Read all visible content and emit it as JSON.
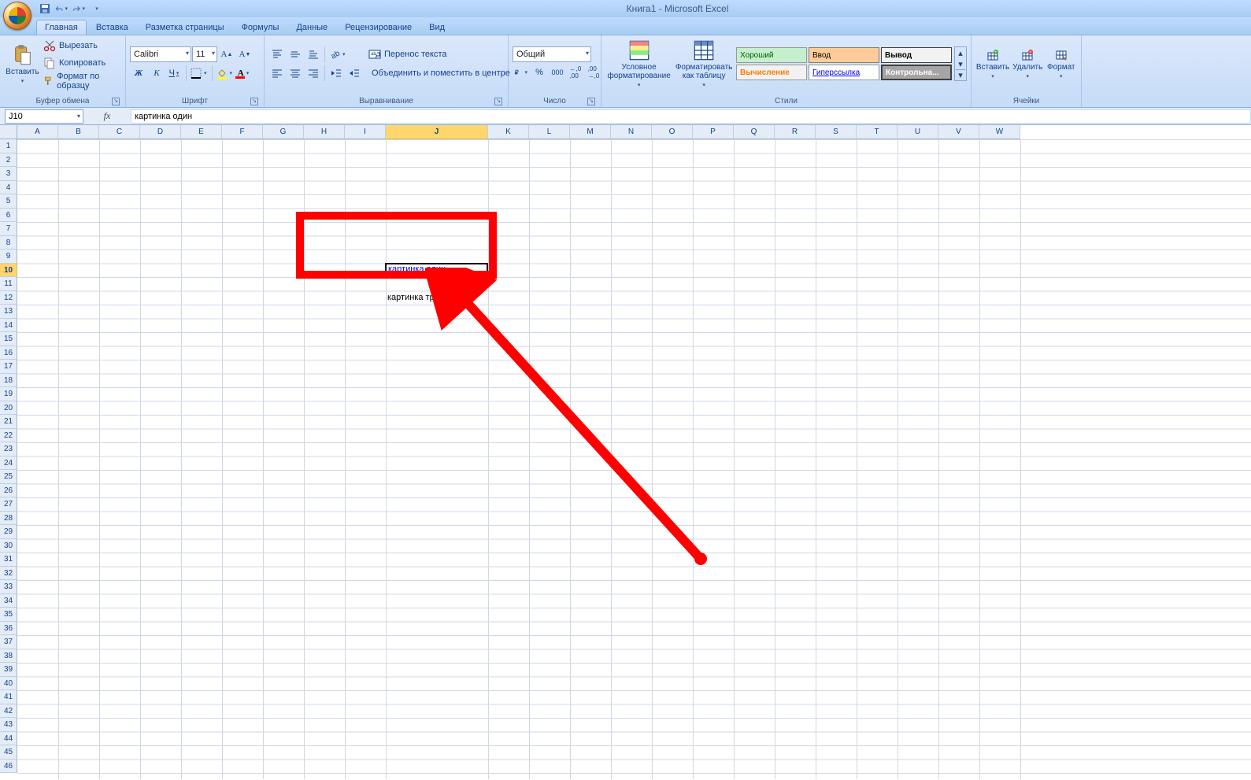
{
  "app_title": "Книга1 - Microsoft Excel",
  "tabs": [
    "Главная",
    "Вставка",
    "Разметка страницы",
    "Формулы",
    "Данные",
    "Рецензирование",
    "Вид"
  ],
  "active_tab": 0,
  "clipboard": {
    "paste": "Вставить",
    "cut": "Вырезать",
    "copy": "Копировать",
    "format_painter": "Формат по образцу",
    "group_label": "Буфер обмена"
  },
  "font": {
    "name": "Calibri",
    "size": "11",
    "bold": "Ж",
    "italic": "К",
    "underline": "Ч",
    "group_label": "Шрифт"
  },
  "alignment": {
    "wrap": "Перенос текста",
    "merge": "Объединить и поместить в центре",
    "group_label": "Выравнивание"
  },
  "number": {
    "format": "Общий",
    "group_label": "Число"
  },
  "styles": {
    "cond": "Условное форматирование",
    "as_table": "Форматировать как таблицу",
    "good": "Хороший",
    "input": "Ввод",
    "output": "Вывод",
    "calc": "Вычисление",
    "hyperlink": "Гиперссылка",
    "check": "Контрольна...",
    "group_label": "Стили"
  },
  "cells_group": {
    "insert": "Вставить",
    "delete": "Удалить",
    "format": "Формат",
    "group_label": "Ячейки"
  },
  "namebox": "J10",
  "formula": "картинка один",
  "grid": {
    "columns": [
      "A",
      "B",
      "C",
      "D",
      "E",
      "F",
      "G",
      "H",
      "I",
      "J",
      "K",
      "L",
      "M",
      "N",
      "O",
      "P",
      "Q",
      "R",
      "S",
      "T",
      "U",
      "V",
      "W"
    ],
    "wide_col_index": 9,
    "selected_col_index": 9,
    "selected_row": 10,
    "row_count": 46,
    "cell_J10": "картинка один",
    "cell_J12": "картинка три"
  }
}
